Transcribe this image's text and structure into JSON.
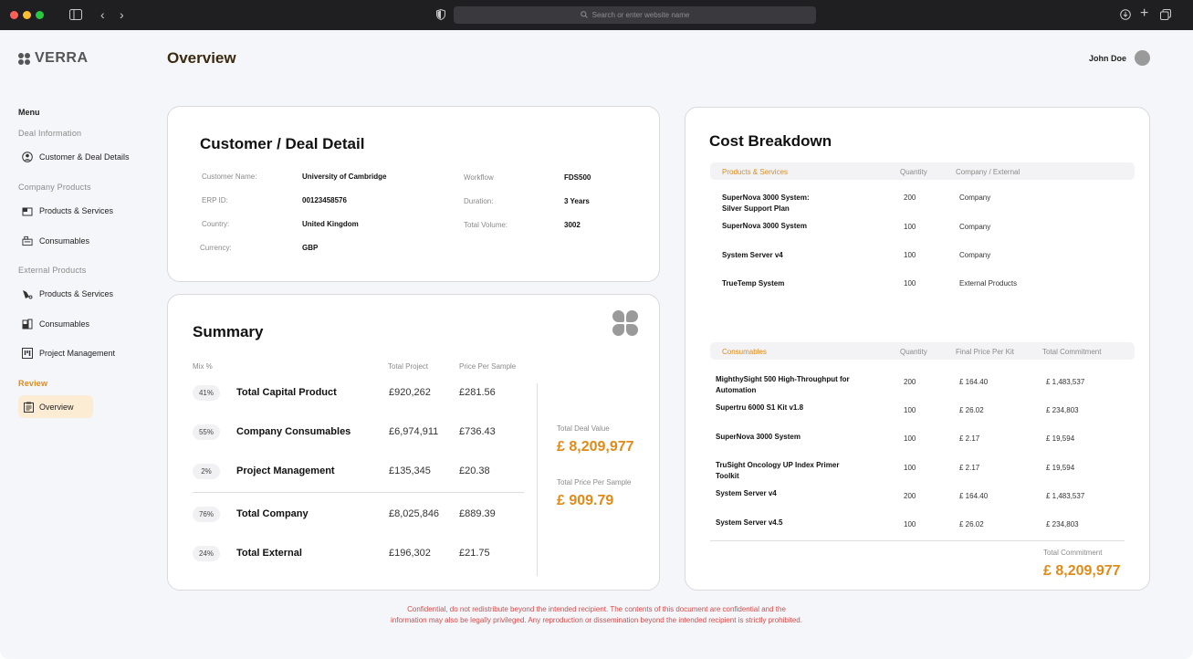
{
  "browser": {
    "address_placeholder": "Search or enter website name"
  },
  "brand": {
    "name": "VERRA"
  },
  "header": {
    "title": "Overview",
    "user_name": "John Doe"
  },
  "sidebar": {
    "menu_label": "Menu",
    "deal_section": "Deal Information",
    "deal_items": [
      "Customer & Deal Details"
    ],
    "company_section": "Company Products",
    "company_items": [
      "Products & Services",
      "Consumables"
    ],
    "external_section": "External Products",
    "external_items": [
      "Products & Services",
      "Consumables",
      "Project Management"
    ],
    "review_section": "Review",
    "review_items": [
      "Overview"
    ]
  },
  "customer": {
    "title": "Customer / Deal Detail",
    "left": [
      {
        "label": "Customer Name:",
        "value": "University of Cambridge"
      },
      {
        "label": "ERP ID:",
        "value": "00123458576"
      },
      {
        "label": "Country:",
        "value": "United Kingdom"
      },
      {
        "label": "Currency:",
        "value": "GBP"
      }
    ],
    "right": [
      {
        "label": "Workflow",
        "value": "FDS500"
      },
      {
        "label": "Duration:",
        "value": "3 Years"
      },
      {
        "label": "Total Volume:",
        "value": "3002"
      }
    ]
  },
  "summary": {
    "title": "Summary",
    "headers": {
      "mix": "Mix %",
      "total_project": "Total Project",
      "price_per_sample": "Price Per Sample"
    },
    "rows": [
      {
        "mix": "41%",
        "name": "Total Capital Product",
        "total": "£920,262",
        "pps": "£281.56"
      },
      {
        "mix": "55%",
        "name": "Company Consumables",
        "total": "£6,974,911",
        "pps": "£736.43"
      },
      {
        "mix": "2%",
        "name": "Project Management",
        "total": "£135,345",
        "pps": "£20.38"
      },
      {
        "mix": "76%",
        "name": "Total Company",
        "total": "£8,025,846",
        "pps": "£889.39"
      },
      {
        "mix": "24%",
        "name": "Total External",
        "total": "£196,302",
        "pps": "£21.75"
      }
    ],
    "total_deal_label": "Total Deal Value",
    "total_deal_value": "£ 8,209,977",
    "total_pps_label": "Total Price Per Sample",
    "total_pps_value": "£ 909.79"
  },
  "cost": {
    "title": "Cost Breakdown",
    "products_headers": {
      "name": "Products & Services",
      "qty": "Quantity",
      "source": "Company / External"
    },
    "products": [
      {
        "name_line1": "SuperNova 3000 System:",
        "name_line2": "Silver Support Plan",
        "qty": "200",
        "source": "Company"
      },
      {
        "name_line1": "SuperNova 3000 System",
        "name_line2": "",
        "qty": "100",
        "source": "Company"
      },
      {
        "name_line1": "System Server v4",
        "name_line2": "",
        "qty": "100",
        "source": "Company"
      },
      {
        "name_line1": "TrueTemp System",
        "name_line2": "",
        "qty": "100",
        "source": "External Products"
      }
    ],
    "consumables_headers": {
      "name": "Consumables",
      "qty": "Quantity",
      "final": "Final Price Per Kit",
      "commit": "Total Commitment"
    },
    "consumables": [
      {
        "name_line1": "MighthySight 500 High-Throughput for",
        "name_line2": "Automation",
        "qty": "200",
        "final": "£ 164.40",
        "commit": "£ 1,483,537"
      },
      {
        "name_line1": "Supertru 6000 S1 Kit v1.8",
        "name_line2": "",
        "qty": "100",
        "final": "£ 26.02",
        "commit": "£ 234,803"
      },
      {
        "name_line1": "SuperNova 3000 System",
        "name_line2": "",
        "qty": "100",
        "final": "£ 2.17",
        "commit": "£ 19,594"
      },
      {
        "name_line1": "TruSight Oncology UP Index Primer",
        "name_line2": "Toolkit",
        "qty": "100",
        "final": "£ 2.17",
        "commit": "£ 19,594"
      },
      {
        "name_line1": "System Server v4",
        "name_line2": "",
        "qty": "200",
        "final": "£ 164.40",
        "commit": "£ 1,483,537"
      },
      {
        "name_line1": "System Server v4.5",
        "name_line2": "",
        "qty": "100",
        "final": "£ 26.02",
        "commit": "£ 234,803"
      }
    ],
    "total_label": "Total Commitment",
    "total_value": "£ 8,209,977"
  },
  "footer": {
    "line1": "Confidential, do not redistribute beyond the intended recipient. The contents of this document are confidential and the",
    "line2": "information may also be legally privileged. Any reproduction or dissemination beyond the intended recipient is strictly prohibited."
  },
  "colors": {
    "accent": "#e08a17",
    "sidebar_active_bg": "#fcecd3",
    "footer_text": "#d64a4a"
  }
}
